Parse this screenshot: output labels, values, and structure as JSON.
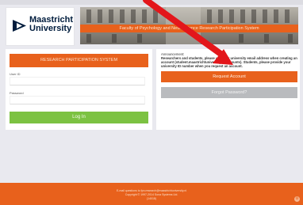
{
  "logo": {
    "line1": "Maastricht",
    "line2": "University"
  },
  "banner": {
    "title": "Faculty of Psychology and Neuroscience Research Participation System"
  },
  "login": {
    "title": "RESEARCH PARTICIPATION SYSTEM",
    "user_id_label": "User ID",
    "user_id_value": "",
    "password_label": "Password",
    "password_value": "",
    "login_button": "Log In"
  },
  "announcement": {
    "heading": "Announcement:",
    "text": "Researchers and students, please use your university email address when creating an account (student.maastrichtuniversity.nl accounts). Students, please provide your university ID number when you request an account."
  },
  "actions": {
    "request_account": "Request Account",
    "forgot_password": "Forgot Password?"
  },
  "footer": {
    "line1": "E-mail questions to fpn.research@maastrichtuniversity.nl",
    "line2": "Copyright © 1997-2014 Sona Systems Ltd.",
    "line3": "(14018)"
  },
  "colors": {
    "accent": "#e8611c",
    "success": "#7cc242",
    "neutral_button": "#b9bbbe",
    "background": "#e9e9ef",
    "annotation_arrow": "#e3161b"
  }
}
